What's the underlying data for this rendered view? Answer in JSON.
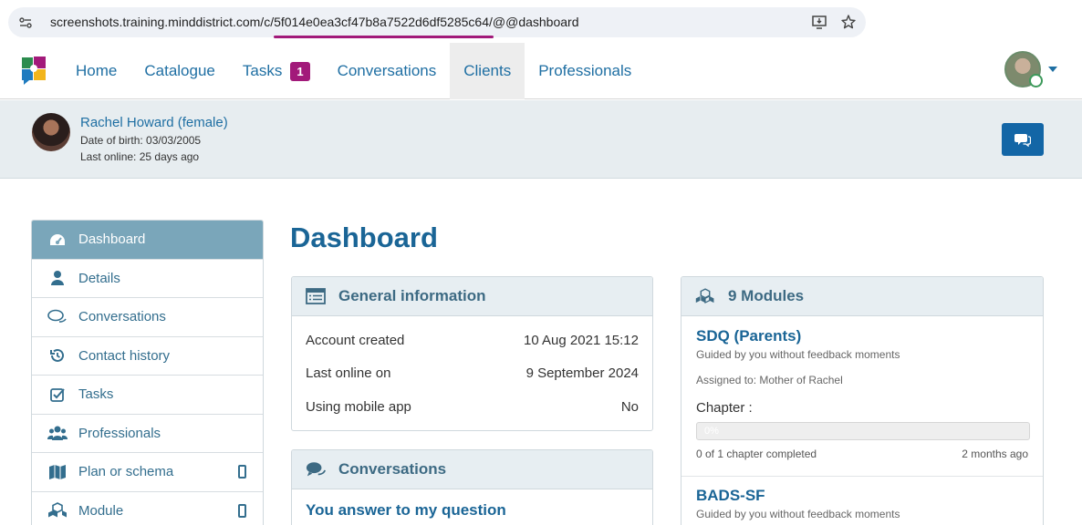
{
  "browser": {
    "url_prefix": "screenshots.training.minddistrict.com/c/",
    "url_highlight": "5f014e0ea3cf47b8a7522d6df5285c64",
    "url_suffix": "/@@dashboard",
    "highlight_color": "#a21a7a"
  },
  "nav": {
    "items": [
      {
        "label": "Home"
      },
      {
        "label": "Catalogue"
      },
      {
        "label": "Tasks",
        "badge": "1"
      },
      {
        "label": "Conversations"
      },
      {
        "label": "Clients",
        "active": true
      },
      {
        "label": "Professionals"
      }
    ]
  },
  "client": {
    "name": "Rachel Howard (female)",
    "dob": "Date of birth: 03/03/2005",
    "last_online": "Last online: 25 days ago"
  },
  "sidebar": {
    "items": [
      {
        "label": "Dashboard",
        "icon": "dashboard-icon",
        "active": true
      },
      {
        "label": "Details",
        "icon": "user-icon"
      },
      {
        "label": "Conversations",
        "icon": "comments-icon"
      },
      {
        "label": "Contact history",
        "icon": "history-icon"
      },
      {
        "label": "Tasks",
        "icon": "check-square-icon"
      },
      {
        "label": "Professionals",
        "icon": "users-icon"
      },
      {
        "label": "Plan or schema",
        "icon": "map-icon",
        "mobile": true
      },
      {
        "label": "Module",
        "icon": "cubes-icon",
        "mobile": true
      }
    ]
  },
  "main": {
    "title": "Dashboard",
    "general_info": {
      "heading": "General information",
      "rows": [
        {
          "label": "Account created",
          "value": "10 Aug 2021 15:12"
        },
        {
          "label": "Last online on",
          "value": "9 September 2024"
        },
        {
          "label": "Using mobile app",
          "value": "No"
        }
      ]
    },
    "conversations": {
      "heading": "Conversations",
      "first_title": "You answer to my question"
    },
    "modules": {
      "heading": "9 Modules",
      "items": [
        {
          "title": "SDQ (Parents)",
          "guidance": "Guided by you without feedback moments",
          "assigned": "Assigned to: Mother of Rachel",
          "chapter_label": "Chapter :",
          "progress_label": "0%",
          "progress": 0,
          "count": "0 of 1 chapter completed",
          "time": "2 months ago"
        },
        {
          "title": "BADS-SF",
          "guidance": "Guided by you without feedback moments"
        }
      ]
    }
  },
  "colors": {
    "brand_blue": "#1a6596",
    "active_sidebar": "#7aa6ba",
    "badge": "#a21a7a",
    "chat_button": "#1366a6"
  }
}
